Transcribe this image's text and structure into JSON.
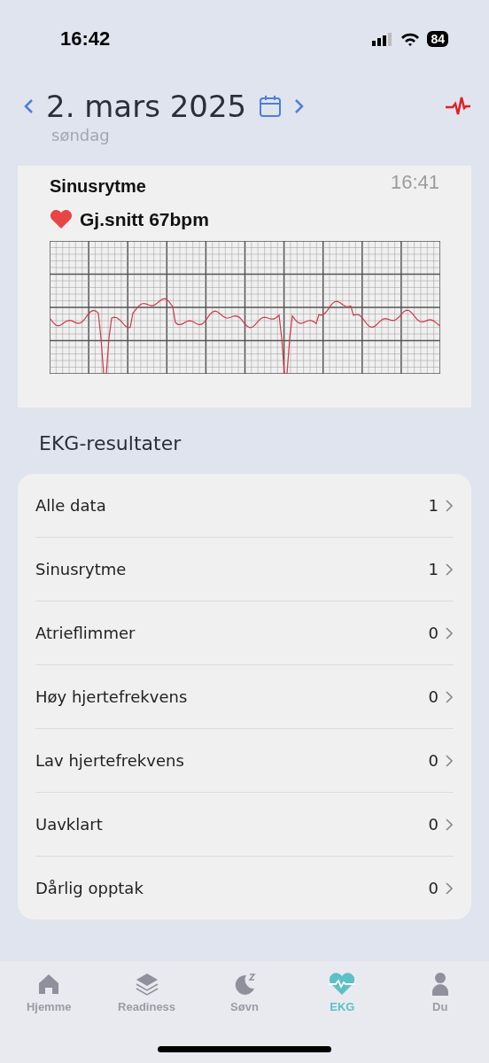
{
  "status_bar": {
    "time": "16:42",
    "battery": "84"
  },
  "header": {
    "date": "2. mars 2025",
    "weekday": "søndag"
  },
  "ecg_card": {
    "title": "Sinusrytme",
    "time": "16:41",
    "average": "Gj.snitt 67bpm"
  },
  "section_title": "EKG-resultater",
  "results": [
    {
      "label": "Alle data",
      "count": "1"
    },
    {
      "label": "Sinusrytme",
      "count": "1"
    },
    {
      "label": "Atrieflimmer",
      "count": "0"
    },
    {
      "label": "Høy hjertefrekvens",
      "count": "0"
    },
    {
      "label": "Lav hjertefrekvens",
      "count": "0"
    },
    {
      "label": "Uavklart",
      "count": "0"
    },
    {
      "label": "Dårlig opptak",
      "count": "0"
    }
  ],
  "tabs": [
    {
      "label": "Hjemme",
      "kind": "home",
      "selected": false
    },
    {
      "label": "Readiness",
      "kind": "layers",
      "selected": false
    },
    {
      "label": "Søvn",
      "kind": "sleep",
      "selected": false
    },
    {
      "label": "EKG",
      "kind": "ecg",
      "selected": true
    },
    {
      "label": "Du",
      "kind": "person",
      "selected": false
    }
  ]
}
